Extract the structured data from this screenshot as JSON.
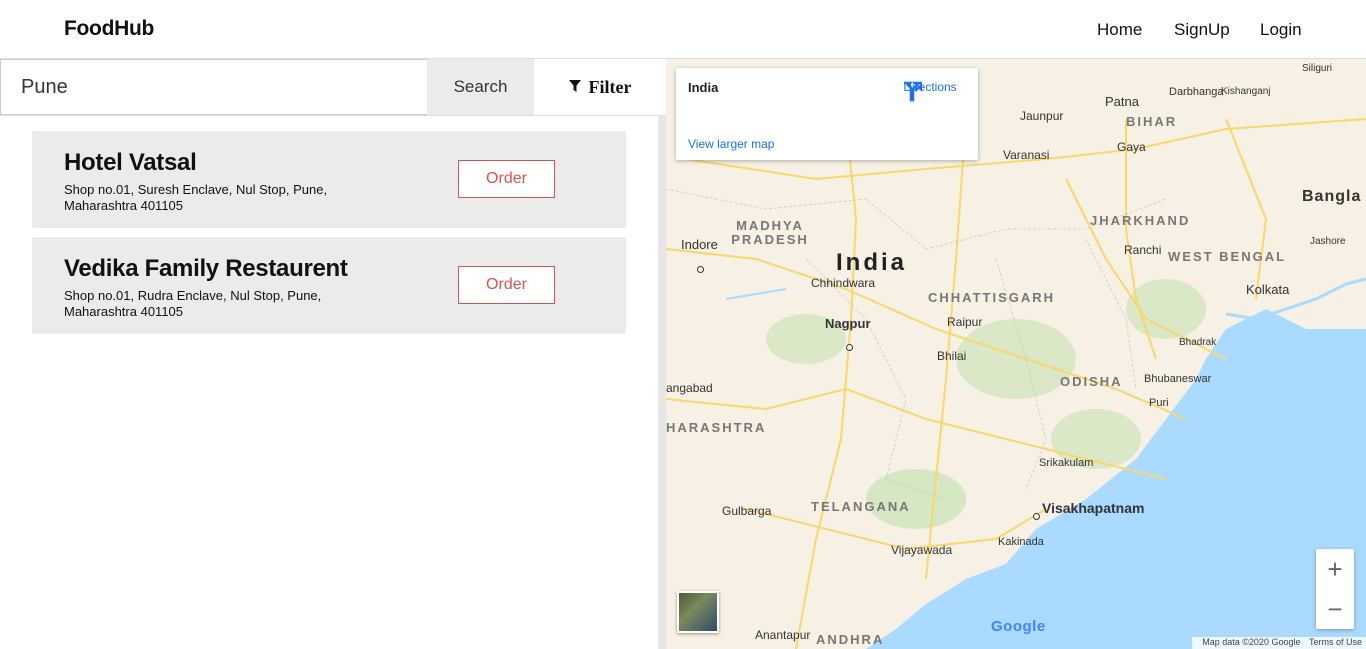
{
  "brand": "FoodHub",
  "nav": {
    "home": "Home",
    "signup": "SignUp",
    "login": "Login"
  },
  "search": {
    "value": "Pune",
    "button": "Search",
    "filter": "Filter"
  },
  "restaurants": [
    {
      "name": "Hotel Vatsal",
      "address": "Shop no.01, Suresh Enclave, Nul Stop, Pune, Maharashtra 401105",
      "action": "Order"
    },
    {
      "name": "Vedika Family Restaurent",
      "address": "Shop no.01, Rudra Enclave, Nul Stop, Pune, Maharashtra 401105",
      "action": "Order"
    }
  ],
  "map": {
    "info": {
      "place": "India",
      "directions": "Directions",
      "larger_map": "View larger map"
    },
    "country": "India",
    "regions": [
      "MADHYA PRADESH",
      "CHHATTISGARH",
      "JHARKHAND",
      "WEST BENGAL",
      "BIHAR",
      "ODISHA",
      "TELANGANA",
      "ANDHRA",
      "HARASHTRA"
    ],
    "cities": [
      "Indore",
      "Chhindwara",
      "Nagpur",
      "Raipur",
      "Bhilai",
      "Patna",
      "Gaya",
      "Ranchi",
      "Kolkata",
      "Varanasi",
      "Jaunpur",
      "Bhubaneswar",
      "Puri",
      "Srikakulam",
      "Visakhapatnam",
      "Kakinada",
      "Vijayawada",
      "Gulbarga",
      "Anantapur",
      "Bhadrak",
      "Jashore",
      "Siliguri",
      "Darbhanga",
      "Kishanganj",
      "angabad",
      "Bangla"
    ],
    "zoom_in": "+",
    "zoom_out": "−",
    "logo": "Google",
    "attribution": "Map data ©2020 Google",
    "terms": "Terms of Use",
    "colors": {
      "water": "#aadaff",
      "land": "#f6f1e4",
      "road": "#fbd66a",
      "forest": "#c9e3b5"
    }
  }
}
